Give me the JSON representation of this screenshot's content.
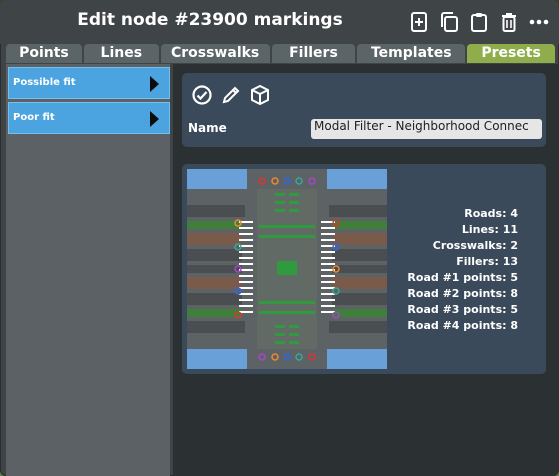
{
  "window": {
    "title": "Edit node #23900 markings"
  },
  "toolbar": {
    "icons": [
      "add-icon",
      "copy-icon",
      "clipboard-icon",
      "delete-icon",
      "more-icon"
    ]
  },
  "tabs": [
    {
      "label": "Points",
      "active": false
    },
    {
      "label": "Lines",
      "active": false
    },
    {
      "label": "Crosswalks",
      "active": false
    },
    {
      "label": "Fillers",
      "active": false
    },
    {
      "label": "Templates",
      "active": false
    },
    {
      "label": "Presets",
      "active": true
    }
  ],
  "sidebar": {
    "items": [
      {
        "label": "Possible fit"
      },
      {
        "label": "Poor fit"
      }
    ]
  },
  "preset": {
    "actions": [
      "apply-icon",
      "edit-icon",
      "package-icon"
    ],
    "name_label": "Name",
    "name_value": "Modal Filter - Neighborhood Connec",
    "stats": [
      "Roads: 4",
      "Lines: 11",
      "Crosswalks: 2",
      "Fillers: 13",
      "Road #1 points: 5",
      "Road #2 points: 8",
      "Road #3 points: 5",
      "Road #4 points: 8"
    ]
  },
  "colors": {
    "active_tab": "#8fad4b",
    "sidebar_item": "#4ba3df",
    "panel": "#3a4a5a"
  }
}
